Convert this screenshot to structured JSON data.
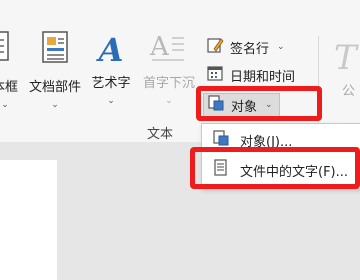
{
  "ribbon": {
    "group_label": "文本",
    "buttons": {
      "textbox_partial": "本框",
      "doc_parts": "文档部件",
      "wordart": "艺术字",
      "dropcap": "首字下沉",
      "wordart_letter": "A",
      "dropcap_letter": "A"
    },
    "right": {
      "signature_line": "签名行",
      "date_time": "日期和时间",
      "object": "对象",
      "partial_icon": "T",
      "partial_label": "公"
    },
    "dropdown_chevron": "⌄"
  },
  "object_menu": {
    "items": [
      {
        "label": "对象(J)..."
      },
      {
        "label": "文件中的文字(F)..."
      }
    ]
  },
  "highlight_color": "#ee1c1c",
  "accent_color": "#2b6cb8"
}
